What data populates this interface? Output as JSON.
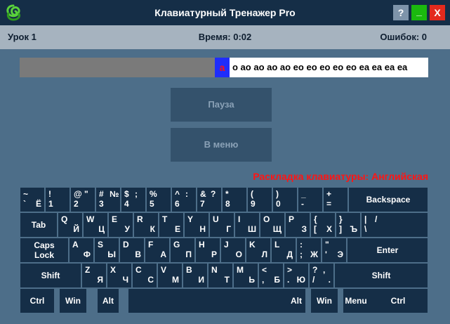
{
  "titlebar": {
    "title": "Клавиатурный Тренажер Pro",
    "help": "?",
    "minimize": "_",
    "close": "X",
    "logo_icon": "knot-logo-icon"
  },
  "status": {
    "lesson": "Урок 1",
    "time": "Время: 0:02",
    "errors": "Ошибок: 0"
  },
  "typing": {
    "current_char": "а",
    "remaining_text": "о ао ао ао ао ео ео ео ео ео еа еа еа еа"
  },
  "buttons": {
    "pause": "Пауза",
    "menu": "В меню"
  },
  "layout_label": "Раскладка клавиатуры: Английская",
  "colors": {
    "background": "#4d6e89",
    "titlebar": "#152e47",
    "statusbar": "#a6b3bf",
    "key": "#152e47",
    "highlight": "#1f2dfa",
    "error": "#ff1414"
  },
  "keyboard": {
    "row1": [
      {
        "id": "tilde",
        "tl": "~",
        "bl": "`",
        "br": "Ё"
      },
      {
        "id": "1",
        "tl": "!",
        "bl": "1"
      },
      {
        "id": "2",
        "tl": "@",
        "tr": "\"",
        "bl": "2"
      },
      {
        "id": "3",
        "tl": "#",
        "tr": "№",
        "bl": "3"
      },
      {
        "id": "4",
        "tl": "$",
        "tr": ";",
        "bl": "4"
      },
      {
        "id": "5",
        "tl": "%",
        "bl": "5"
      },
      {
        "id": "6",
        "tl": "^",
        "tr": ":",
        "bl": "6"
      },
      {
        "id": "7",
        "tl": "&",
        "tr": "?",
        "bl": "7"
      },
      {
        "id": "8",
        "tl": "*",
        "bl": "8"
      },
      {
        "id": "9",
        "tl": "(",
        "bl": "9"
      },
      {
        "id": "0",
        "tl": ")",
        "bl": "0"
      },
      {
        "id": "minus",
        "tl": "_",
        "bl": "-"
      },
      {
        "id": "equal",
        "tl": "+",
        "bl": "="
      },
      {
        "id": "backspace",
        "c": "Backspace"
      }
    ],
    "row2": [
      {
        "id": "tab",
        "c": "Tab"
      },
      {
        "id": "q",
        "tl": "Q",
        "br": "Й"
      },
      {
        "id": "w",
        "tl": "W",
        "br": "Ц"
      },
      {
        "id": "e",
        "tl": "E",
        "br": "У"
      },
      {
        "id": "r",
        "tl": "R",
        "br": "К"
      },
      {
        "id": "t",
        "tl": "T",
        "br": "Е"
      },
      {
        "id": "y",
        "tl": "Y",
        "br": "Н"
      },
      {
        "id": "u",
        "tl": "U",
        "br": "Г"
      },
      {
        "id": "i",
        "tl": "I",
        "br": "Ш"
      },
      {
        "id": "o",
        "tl": "O",
        "br": "Щ"
      },
      {
        "id": "p",
        "tl": "P",
        "br": "З"
      },
      {
        "id": "lbracket",
        "tl": "{",
        "bl": "[",
        "br": "Х"
      },
      {
        "id": "rbracket",
        "tl": "}",
        "bl": "]",
        "br": "Ъ"
      },
      {
        "id": "backslash",
        "tl": "|",
        "tr": "/",
        "bl": "\\"
      }
    ],
    "row3": [
      {
        "id": "caps",
        "c": "Caps\nLock"
      },
      {
        "id": "a",
        "tl": "A",
        "br": "Ф"
      },
      {
        "id": "s",
        "tl": "S",
        "br": "Ы"
      },
      {
        "id": "d",
        "tl": "D",
        "br": "В"
      },
      {
        "id": "f",
        "tl": "F",
        "br": "А"
      },
      {
        "id": "g",
        "tl": "G",
        "br": "П"
      },
      {
        "id": "h",
        "tl": "H",
        "br": "Р"
      },
      {
        "id": "j",
        "tl": "J",
        "br": "О"
      },
      {
        "id": "k",
        "tl": "K",
        "br": "Л"
      },
      {
        "id": "l",
        "tl": "L",
        "br": "Д"
      },
      {
        "id": "semicolon",
        "tl": ":",
        "bl": ";",
        "br": "Ж"
      },
      {
        "id": "quote",
        "tl": "\"",
        "bl": "'",
        "br": "Э"
      },
      {
        "id": "enter",
        "c": "Enter"
      }
    ],
    "row4": [
      {
        "id": "lshift",
        "c": "Shift"
      },
      {
        "id": "z",
        "tl": "Z",
        "br": "Я"
      },
      {
        "id": "x",
        "tl": "X",
        "br": "Ч"
      },
      {
        "id": "c",
        "tl": "C",
        "br": "С"
      },
      {
        "id": "v",
        "tl": "V",
        "br": "М"
      },
      {
        "id": "b",
        "tl": "B",
        "br": "И"
      },
      {
        "id": "n",
        "tl": "N",
        "br": "Т"
      },
      {
        "id": "m",
        "tl": "M",
        "br": "Ь"
      },
      {
        "id": "comma",
        "tl": "<",
        "bl": ",",
        "br": "Б"
      },
      {
        "id": "period",
        "tl": ">",
        "bl": ".",
        "br": "Ю"
      },
      {
        "id": "slash",
        "tl": "?",
        "tr": ",",
        "bl": "/",
        "br": "."
      },
      {
        "id": "rshift",
        "c": "Shift"
      }
    ],
    "row5": [
      {
        "id": "lctrl",
        "c": "Ctrl"
      },
      {
        "id": "lwin",
        "c": "Win"
      },
      {
        "id": "lalt",
        "c": "Alt"
      },
      {
        "id": "space",
        "c": ""
      },
      {
        "id": "ralt",
        "c": "Alt"
      },
      {
        "id": "rwin",
        "c": "Win"
      },
      {
        "id": "menu",
        "c": "Menu"
      },
      {
        "id": "rctrl",
        "c": "Ctrl"
      }
    ]
  }
}
